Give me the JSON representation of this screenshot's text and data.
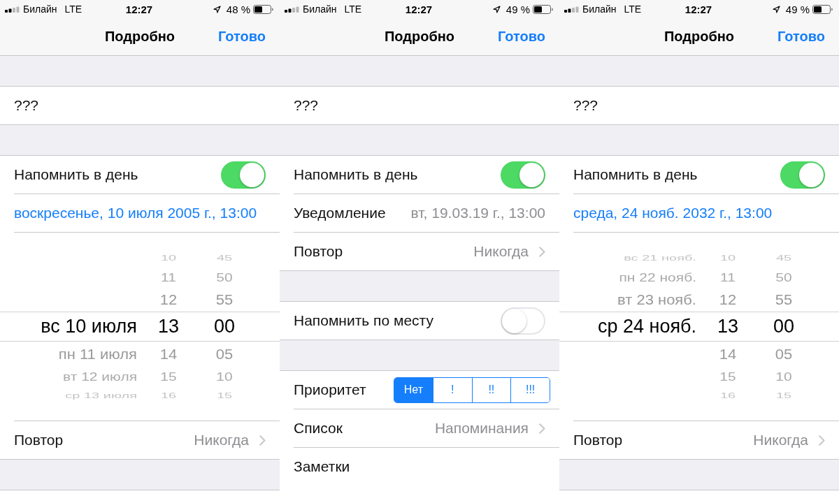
{
  "screens": [
    {
      "status_bar": {
        "carrier": "Билайн",
        "network": "LTE",
        "time": "12:27",
        "battery": "48 %"
      },
      "nav_bar": {
        "title": "Подробно",
        "done": "Готово"
      },
      "sections": [
        {
          "rows": [
            {
              "kind": "title",
              "value": "???"
            }
          ]
        },
        {
          "rows": [
            {
              "kind": "toggle",
              "label": "Напомнить в день",
              "on": true
            },
            {
              "kind": "link",
              "label": "воскресенье, 10 июля 2005 г., 13:00"
            },
            {
              "kind": "picker",
              "columns": [
                {
                  "kind": "day",
                  "items": [
                    {
                      "text": "вс 10 июля",
                      "selected": true
                    },
                    {
                      "text": "пн 11 июля",
                      "selected": false
                    },
                    {
                      "text": "вт 12 июля",
                      "selected": false
                    },
                    {
                      "text": "ср 13 июля",
                      "selected": false
                    }
                  ]
                },
                {
                  "kind": "hour",
                  "items": [
                    {
                      "text": "10",
                      "selected": false
                    },
                    {
                      "text": "11",
                      "selected": false
                    },
                    {
                      "text": "12",
                      "selected": false
                    },
                    {
                      "text": "13",
                      "selected": true
                    },
                    {
                      "text": "14",
                      "selected": false
                    },
                    {
                      "text": "15",
                      "selected": false
                    },
                    {
                      "text": "16",
                      "selected": false
                    }
                  ]
                },
                {
                  "kind": "minute",
                  "items": [
                    {
                      "text": "45",
                      "selected": false
                    },
                    {
                      "text": "50",
                      "selected": false
                    },
                    {
                      "text": "55",
                      "selected": false
                    },
                    {
                      "text": "00",
                      "selected": true
                    },
                    {
                      "text": "05",
                      "selected": false
                    },
                    {
                      "text": "10",
                      "selected": false
                    },
                    {
                      "text": "15",
                      "selected": false
                    }
                  ]
                }
              ]
            },
            {
              "kind": "disclosure",
              "label": "Повтор",
              "value": "Никогда"
            }
          ]
        }
      ]
    },
    {
      "status_bar": {
        "carrier": "Билайн",
        "network": "LTE",
        "time": "12:27",
        "battery": "49 %"
      },
      "nav_bar": {
        "title": "Подробно",
        "done": "Готово"
      },
      "sections": [
        {
          "rows": [
            {
              "kind": "title",
              "value": "???"
            }
          ]
        },
        {
          "rows": [
            {
              "kind": "toggle",
              "label": "Напомнить в день",
              "on": true
            },
            {
              "kind": "value",
              "label": "Уведомление",
              "value": "вт, 19.03.19 г., 13:00"
            },
            {
              "kind": "disclosure",
              "label": "Повтор",
              "value": "Никогда"
            }
          ]
        },
        {
          "rows": [
            {
              "kind": "toggle",
              "label": "Напомнить по месту",
              "on": false
            }
          ]
        },
        {
          "rows": [
            {
              "kind": "segmented",
              "label": "Приоритет",
              "segments": [
                {
                  "label": "Нет",
                  "selected": true
                },
                {
                  "label": "!",
                  "selected": false
                },
                {
                  "label": "!!",
                  "selected": false
                },
                {
                  "label": "!!!",
                  "selected": false
                }
              ]
            },
            {
              "kind": "disclosure",
              "label": "Список",
              "value": "Напоминания"
            },
            {
              "kind": "notes",
              "label": "Заметки"
            }
          ]
        }
      ]
    },
    {
      "status_bar": {
        "carrier": "Билайн",
        "network": "LTE",
        "time": "12:27",
        "battery": "49 %"
      },
      "nav_bar": {
        "title": "Подробно",
        "done": "Готово"
      },
      "sections": [
        {
          "rows": [
            {
              "kind": "title",
              "value": "???"
            }
          ]
        },
        {
          "rows": [
            {
              "kind": "toggle",
              "label": "Напомнить в день",
              "on": true
            },
            {
              "kind": "link",
              "label": "среда, 24 нояб. 2032 г., 13:00"
            },
            {
              "kind": "picker",
              "columns": [
                {
                  "kind": "day",
                  "items": [
                    {
                      "text": "вс 21 нояб.",
                      "selected": false
                    },
                    {
                      "text": "пн 22 нояб.",
                      "selected": false
                    },
                    {
                      "text": "вт 23 нояб.",
                      "selected": false
                    },
                    {
                      "text": "ср 24 нояб.",
                      "selected": true
                    }
                  ]
                },
                {
                  "kind": "hour",
                  "items": [
                    {
                      "text": "10",
                      "selected": false
                    },
                    {
                      "text": "11",
                      "selected": false
                    },
                    {
                      "text": "12",
                      "selected": false
                    },
                    {
                      "text": "13",
                      "selected": true
                    },
                    {
                      "text": "14",
                      "selected": false
                    },
                    {
                      "text": "15",
                      "selected": false
                    },
                    {
                      "text": "16",
                      "selected": false
                    }
                  ]
                },
                {
                  "kind": "minute",
                  "items": [
                    {
                      "text": "45",
                      "selected": false
                    },
                    {
                      "text": "50",
                      "selected": false
                    },
                    {
                      "text": "55",
                      "selected": false
                    },
                    {
                      "text": "00",
                      "selected": true
                    },
                    {
                      "text": "05",
                      "selected": false
                    },
                    {
                      "text": "10",
                      "selected": false
                    },
                    {
                      "text": "15",
                      "selected": false
                    }
                  ]
                }
              ]
            },
            {
              "kind": "disclosure",
              "label": "Повтор",
              "value": "Никогда"
            }
          ]
        }
      ]
    }
  ]
}
